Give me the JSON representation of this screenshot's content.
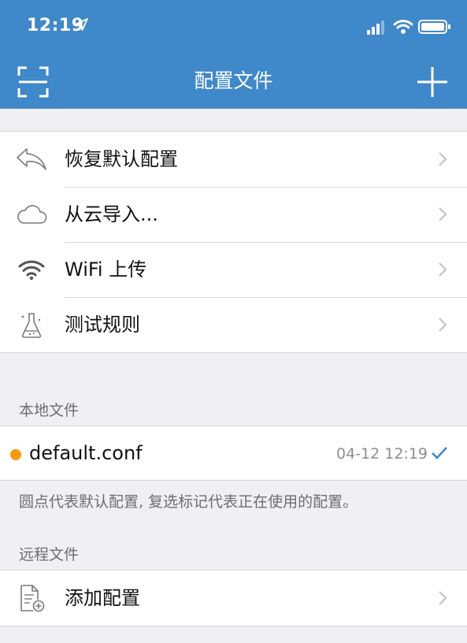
{
  "status_bar": {
    "time": "12:19"
  },
  "nav": {
    "title": "配置文件"
  },
  "menu_items": [
    {
      "label": "恢复默认配置",
      "icon": "restore-icon"
    },
    {
      "label": "从云导入...",
      "icon": "cloud-icon"
    },
    {
      "label": "WiFi 上传",
      "icon": "wifi-icon"
    },
    {
      "label": "测试规则",
      "icon": "flask-icon"
    }
  ],
  "local_files": {
    "header": "本地文件",
    "items": [
      {
        "name": "default.conf",
        "time": "04-12 12:19"
      }
    ],
    "note": "圆点代表默认配置, 复选标记代表正在使用的配置。"
  },
  "remote_files": {
    "header": "远程文件",
    "add_label": "添加配置"
  },
  "colors": {
    "bar": "#3f88c9",
    "default_dot": "#f79a0a",
    "check": "#3f88c9"
  }
}
